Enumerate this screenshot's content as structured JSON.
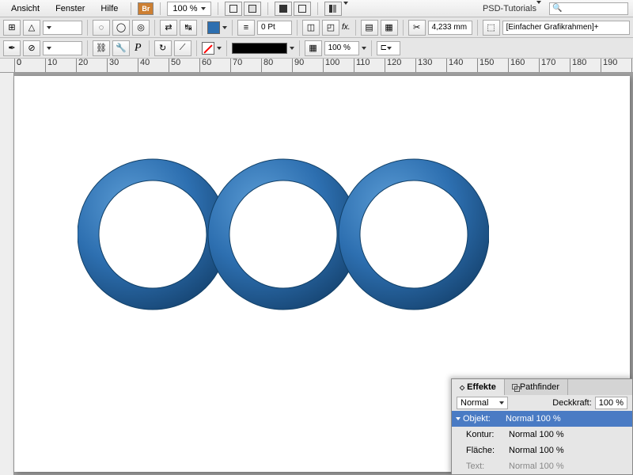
{
  "menu": {
    "items": [
      "Ansicht",
      "Fenster",
      "Hilfe"
    ],
    "bridge": "Br",
    "zoom": "100 %",
    "workspace": "PSD-Tutorials"
  },
  "toolbar": {
    "pt_value": "0 Pt",
    "pct_value": "100 %",
    "dim_value": "4,233 mm",
    "frame_label": "[Einfacher Grafikrahmen]+"
  },
  "ruler_tick": "0",
  "panel": {
    "tab1": "Effekte",
    "tab2": "Pathfinder",
    "blend": "Normal",
    "opacity_label": "Deckkraft:",
    "opacity_value": "100 %",
    "rows": [
      {
        "label": "Objekt:",
        "value": "Normal 100 %"
      },
      {
        "label": "Kontur:",
        "value": "Normal 100 %"
      },
      {
        "label": "Fläche:",
        "value": "Normal 100 %"
      },
      {
        "label": "Text:",
        "value": "Normal 100 %"
      }
    ]
  }
}
